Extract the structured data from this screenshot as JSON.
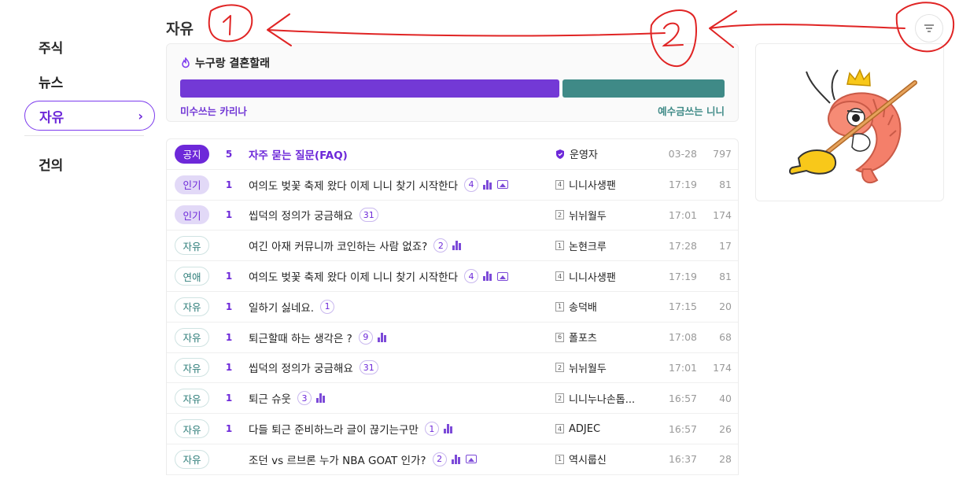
{
  "sidebar": {
    "items": [
      {
        "label": "주식",
        "active": false
      },
      {
        "label": "뉴스",
        "active": false
      },
      {
        "label": "자유",
        "active": true
      },
      {
        "label": "건의",
        "active": false
      }
    ]
  },
  "page_title": "자유",
  "poll": {
    "title": "누구랑 결혼할래",
    "option_a": {
      "label": "미수쓰는 카리나",
      "share": 0.7,
      "color": "#7339d6"
    },
    "option_b": {
      "label": "예수금쓰는 니니",
      "share": 0.3,
      "color": "#3f8a87"
    }
  },
  "posts": [
    {
      "badge": "공지",
      "badge_type": "notice",
      "rank": "5",
      "title": "자주 묻는 질문(FAQ)",
      "comments": "",
      "has_chart": false,
      "has_image": false,
      "author_level": "",
      "author": "운영자",
      "is_admin": true,
      "time": "03-28",
      "views": "797"
    },
    {
      "badge": "인기",
      "badge_type": "hot",
      "rank": "1",
      "title": "여의도 벚꽃 축제 왔다 이제 니니 찾기 시작한다",
      "comments": "4",
      "has_chart": true,
      "has_image": true,
      "author_level": "4",
      "author": "니니사생팬",
      "is_admin": false,
      "time": "17:19",
      "views": "81"
    },
    {
      "badge": "인기",
      "badge_type": "hot",
      "rank": "1",
      "title": "씹덕의 정의가 궁금해요",
      "comments": "31",
      "has_chart": false,
      "has_image": false,
      "author_level": "2",
      "author": "뉘뉘월두",
      "is_admin": false,
      "time": "17:01",
      "views": "174"
    },
    {
      "badge": "자유",
      "badge_type": "free",
      "rank": "",
      "title": "여긴 아재 커뮤니까 코인하는 사람 없죠?",
      "comments": "2",
      "has_chart": true,
      "has_image": false,
      "author_level": "1",
      "author": "논현크루",
      "is_admin": false,
      "time": "17:28",
      "views": "17"
    },
    {
      "badge": "연애",
      "badge_type": "free",
      "rank": "1",
      "title": "여의도 벚꽃 축제 왔다 이제 니니 찾기 시작한다",
      "comments": "4",
      "has_chart": true,
      "has_image": true,
      "author_level": "4",
      "author": "니니사생팬",
      "is_admin": false,
      "time": "17:19",
      "views": "81"
    },
    {
      "badge": "자유",
      "badge_type": "free",
      "rank": "1",
      "title": "일하기 싫네요.",
      "comments": "1",
      "has_chart": false,
      "has_image": false,
      "author_level": "1",
      "author": "송덕배",
      "is_admin": false,
      "time": "17:15",
      "views": "20"
    },
    {
      "badge": "자유",
      "badge_type": "free",
      "rank": "1",
      "title": "퇴근할때 하는 생각은 ?",
      "comments": "9",
      "has_chart": true,
      "has_image": false,
      "author_level": "6",
      "author": "폴포츠",
      "is_admin": false,
      "time": "17:08",
      "views": "68"
    },
    {
      "badge": "자유",
      "badge_type": "free",
      "rank": "1",
      "title": "씹덕의 정의가 궁금해요",
      "comments": "31",
      "has_chart": false,
      "has_image": false,
      "author_level": "2",
      "author": "뉘뉘월두",
      "is_admin": false,
      "time": "17:01",
      "views": "174"
    },
    {
      "badge": "자유",
      "badge_type": "free",
      "rank": "1",
      "title": "퇴근 슈웃",
      "comments": "3",
      "has_chart": true,
      "has_image": false,
      "author_level": "2",
      "author": "니니누나손톱...",
      "is_admin": false,
      "time": "16:57",
      "views": "40"
    },
    {
      "badge": "자유",
      "badge_type": "free",
      "rank": "1",
      "title": "다들 퇴근 준비하느라 글이 끊기는구만",
      "comments": "1",
      "has_chart": true,
      "has_image": false,
      "author_level": "4",
      "author": "ADJEC",
      "is_admin": false,
      "time": "16:57",
      "views": "26"
    },
    {
      "badge": "자유",
      "badge_type": "free",
      "rank": "",
      "title": "조던 vs 르브론 누가 NBA GOAT 인가?",
      "comments": "2",
      "has_chart": true,
      "has_image": true,
      "author_level": "1",
      "author": "역시룹신",
      "is_admin": false,
      "time": "16:37",
      "views": "28"
    }
  ],
  "icons": {
    "filter": "filter-icon",
    "fire": "fire-icon",
    "shield": "shield-icon",
    "chevron": "chevron-right-icon"
  },
  "annotations": {
    "mark_1": "1",
    "mark_2": "2",
    "color": "#e02424"
  }
}
